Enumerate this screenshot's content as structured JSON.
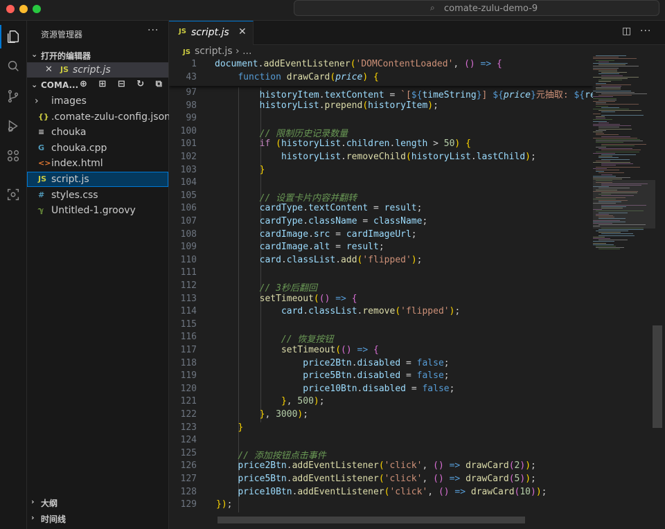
{
  "window": {
    "command_center": "comate-zulu-demo-9"
  },
  "sidebar": {
    "title": "资源管理器",
    "more": "···",
    "open_editors": {
      "label": "打开的编辑器",
      "items": [
        {
          "icon": "JS",
          "close": "✕",
          "name": "script.js"
        }
      ]
    },
    "workspace": {
      "label": "COMA...",
      "action_icons": "⊕ ⊞ ⊟ ↻ ⧉"
    },
    "files": [
      {
        "icon": "›",
        "name": "images",
        "icon_color": "#cccccc"
      },
      {
        "icon": "{}",
        "name": ".comate-zulu-config.json",
        "icon_color": "#cbcb41"
      },
      {
        "icon": "≡",
        "name": "chouka",
        "icon_color": "#cccccc"
      },
      {
        "icon": "G",
        "name": "chouka.cpp",
        "icon_color": "#519aba"
      },
      {
        "icon": "<>",
        "name": "index.html",
        "icon_color": "#e37933"
      },
      {
        "icon": "JS",
        "name": "script.js",
        "icon_color": "#cbcb41"
      },
      {
        "icon": "#",
        "name": "styles.css",
        "icon_color": "#519aba"
      },
      {
        "icon": "ℽ",
        "name": "Untitled-1.groovy",
        "icon_color": "#8dc149"
      }
    ],
    "bottom_sections": [
      {
        "chev": "›",
        "label": "大纲"
      },
      {
        "chev": "›",
        "label": "时间线"
      }
    ]
  },
  "editor": {
    "tab": {
      "icon": "JS",
      "name": "script.js",
      "close": "✕"
    },
    "tab_actions": {
      "split": "◫",
      "more": "···"
    },
    "breadcrumb": {
      "icon": "JS",
      "file": "script.js",
      "sep": " › ",
      "rest": "..."
    },
    "line_numbers": {
      "sticky": [
        "1",
        "43"
      ],
      "body": [
        "97",
        "98",
        "99",
        "100",
        "101",
        "102",
        "103",
        "104",
        "105",
        "106",
        "107",
        "108",
        "109",
        "110",
        "111",
        "112",
        "113",
        "114",
        "115",
        "116",
        "117",
        "118",
        "119",
        "120",
        "121",
        "122",
        "123",
        "124",
        "125",
        "126",
        "127",
        "128",
        "129"
      ]
    },
    "sticky_code": [
      "document.addEventListener('DOMContentLoaded', () => {",
      "    function drawCard(price) {"
    ],
    "code_lines": [
      "        historyItem.textContent = `[${timeString}] ${price}元抽取: ${result",
      "        historyList.prepend(historyItem);",
      "",
      "        // 限制历史记录数量",
      "        if (historyList.children.length > 50) {",
      "            historyList.removeChild(historyList.lastChild);",
      "        }",
      "",
      "        // 设置卡片内容并翻转",
      "        cardType.textContent = result;",
      "        cardType.className = className;",
      "        cardImage.src = cardImageUrl;",
      "        cardImage.alt = result;",
      "        card.classList.add('flipped');",
      "",
      "        // 3秒后翻回",
      "        setTimeout(() => {",
      "            card.classList.remove('flipped');",
      "",
      "            // 恢复按钮",
      "            setTimeout(() => {",
      "                price2Btn.disabled = false;",
      "                price5Btn.disabled = false;",
      "                price10Btn.disabled = false;",
      "            }, 500);",
      "        }, 3000);",
      "    }",
      "",
      "    // 添加按钮点击事件",
      "    price2Btn.addEventListener('click', () => drawCard(2));",
      "    price5Btn.addEventListener('click', () => drawCard(5));",
      "    price10Btn.addEventListener('click', () => drawCard(10));",
      "});"
    ]
  },
  "colors": {
    "accent": "#0078d4",
    "keyword": "#c586c0",
    "function": "#dcdcaa",
    "variable": "#9cdcfe",
    "string": "#ce9178",
    "number": "#b5cea8",
    "comment": "#6a9955"
  }
}
